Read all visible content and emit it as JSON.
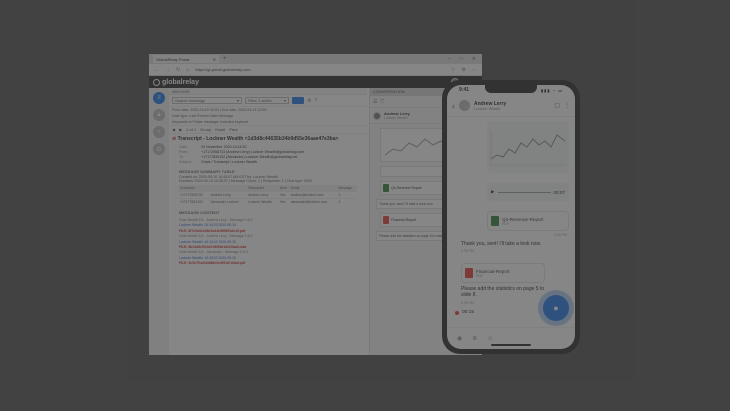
{
  "browser": {
    "tab_title": "GlobalRelay Portal",
    "new_tab": "+",
    "win_controls": [
      "–",
      "□",
      "✕"
    ],
    "url": "https://gr.portal.globalrelay.com",
    "nav_icons": [
      "back-icon",
      "forward-icon",
      "refresh-icon",
      "home-icon"
    ]
  },
  "app": {
    "logo": "globalrelay",
    "user": "Sidney_w"
  },
  "archive": {
    "header": "ARCHIVE",
    "filter_search": "Search message",
    "filter_1": "Filter 1 active",
    "meta_1": "From date: 2020-04-10 00:00  |  End date: 2020-04-14 23:59",
    "meta_2": "Date type: Last Review Date Message",
    "meta_3": "Keywords in Folder message: Included keyword",
    "toolbar_page": "1 of 1",
    "toolbar_items": [
      "Group",
      "Email",
      "Print"
    ],
    "subject": "Transcript - Lockner Wealth <1d3d8c44635b34b9d55e36aae47e3ba>",
    "headers": [
      {
        "k": "Date:",
        "v": "20 November 2020 10:14:20"
      },
      {
        "k": "From:",
        "v": "+17172908733 (Andrew Lerry) Lockner Wealth@globalrelay.com"
      },
      {
        "k": "To:",
        "v": "+17177834102 (Alexander) Lockner Wealth@globalrelay.net"
      },
      {
        "k": "Subject:",
        "v": "Chats / Transcript / Lockner Wealth"
      }
    ],
    "summary_title": "MESSAGE SUMMARY TABLE",
    "summary_text": "Created on: 2020-09-10 10:45:07 AM EST by: Lockner Wealth",
    "summary_text_2": "Duration: 2020-09-10 10:45:07 | Message Count: 1 | Recipients: 1 | Chat type: SMS",
    "summary_cols": [
      "Customer",
      "Participant",
      "Sent",
      "Email",
      "Message"
    ],
    "summary_rows": [
      [
        "+17172908733",
        "Andrew Lerry",
        "Andrew Lerry",
        "Yes",
        "andrew@lockner.com",
        "1"
      ],
      [
        "+17177834102",
        "Alexander Lockner",
        "Lockner Wealth",
        "Yes",
        "alexander@lockner.com",
        "2"
      ]
    ],
    "content_title": "MESSAGE CONTENT",
    "content_lines": [
      {
        "t": "Chat Wealth 111 - Andrew Lerry - Message 1 of 2",
        "c": ""
      },
      {
        "t": "Lockner Wealth: 10:14:20 2020-09-10",
        "c": "lnk"
      },
      {
        "t": "FILE: 8f7c0a3e2e8d1b43c96087a2e19.pdf",
        "c": "red"
      },
      {
        "t": "Chat Wealth 111 - Andrew Lerry - Message 2 of 2",
        "c": ""
      },
      {
        "t": "Lockner Wealth: 10:14:41 2020-09-10",
        "c": "lnk"
      },
      {
        "t": "FILE: 5b12d6cf9c0a7e8f84b1d2e0aa4.m4a",
        "c": "red"
      },
      {
        "t": "Chat Wealth 111 - Alexander - Message 3 of 3",
        "c": ""
      },
      {
        "t": "Lockner Wealth: 10:15:02 2020-09-10",
        "c": "lnk"
      },
      {
        "t": "FILE: 3c9e7f1a2d4b86e0c5f91b7d3ad.pdf",
        "c": "red"
      }
    ]
  },
  "conversation": {
    "header": "CONVERSATION",
    "contact_name": "Andrew Lerry",
    "contact_sub": "Lockner Wealth",
    "files": [
      "Q4-Revenue-Report",
      "Financial-Report"
    ],
    "file_types": [
      "PDF",
      "PDF"
    ],
    "bubble_1": "Thank you, sent! I'll take a look now.",
    "bubble_2": "Please add the statistics on page 5 to slide 8."
  },
  "phone": {
    "time": "9:41",
    "signal": "▮▮▮ ◔ ▭",
    "contact_name": "Andrew Lerry",
    "contact_sub": "Lockner Wealth",
    "audio_time": "00:07",
    "file_1": "Q4-Revenue-Report",
    "file_1_sub": "PDF",
    "file_1_time": "2:05 PM",
    "msg_1": "Thank you, sent! I'll take a look now.",
    "msg_1_time": "2:06 PM",
    "file_2": "Financial-Report",
    "file_2_sub": "PDF",
    "msg_2": "Please add the statistics on page 5 to slide 8.",
    "msg_2_time": "2:08 PM",
    "recording": "00:15",
    "colors": {
      "accent": "#1a73e8",
      "record": "#e53935",
      "pdf": "#e53935",
      "sheet": "#2e7d32"
    }
  }
}
